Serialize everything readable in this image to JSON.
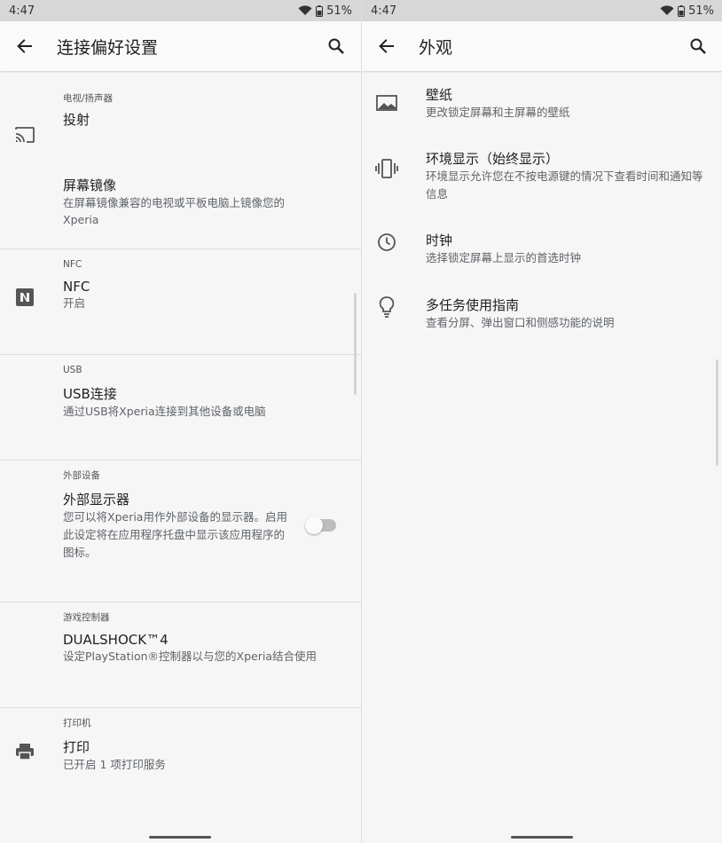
{
  "left": {
    "status": {
      "time": "4:47",
      "battery": "51%"
    },
    "appbar": {
      "title": "连接偏好设置"
    },
    "sections": {
      "tv": {
        "header": "电视/扬声器",
        "cast": {
          "title": "投射"
        },
        "mirror": {
          "title": "屏幕镜像",
          "subtitle": "在屏幕镜像兼容的电视或平板电脑上镜像您的Xperia"
        }
      },
      "nfc": {
        "header": "NFC",
        "item": {
          "title": "NFC",
          "subtitle": "开启"
        }
      },
      "usb": {
        "header": "USB",
        "item": {
          "title": "USB连接",
          "subtitle": "通过USB将Xperia连接到其他设备或电脑"
        }
      },
      "external": {
        "header": "外部设备",
        "item": {
          "title": "外部显示器",
          "subtitle": "您可以将Xperia用作外部设备的显示器。启用此设定将在应用程序托盘中显示该应用程序的图标。",
          "toggle_on": false
        }
      },
      "game": {
        "header": "游戏控制器",
        "item": {
          "title": "DUALSHOCK™4",
          "subtitle": "设定PlayStation®控制器以与您的Xperia结合使用"
        }
      },
      "print": {
        "header": "打印机",
        "item": {
          "title": "打印",
          "subtitle": "已开启 1 项打印服务"
        }
      }
    }
  },
  "right": {
    "status": {
      "time": "4:47",
      "battery": "51%"
    },
    "appbar": {
      "title": "外观"
    },
    "items": [
      {
        "title": "壁纸",
        "subtitle": "更改锁定屏幕和主屏幕的壁纸",
        "icon": "wallpaper-icon"
      },
      {
        "title": "环境显示（始终显示）",
        "subtitle": "环境显示允许您在不按电源键的情况下查看时间和通知等信息",
        "icon": "ambient-display-icon"
      },
      {
        "title": "时钟",
        "subtitle": "选择锁定屏幕上显示的首选时钟",
        "icon": "clock-icon"
      },
      {
        "title": "多任务使用指南",
        "subtitle": "查看分屏、弹出窗口和侧感功能的说明",
        "icon": "lightbulb-icon"
      }
    ]
  },
  "colors": {
    "background": "#f6f6f6",
    "statusbar": "#d7d7d7",
    "text": "#202124",
    "secondary": "#5f6368"
  }
}
